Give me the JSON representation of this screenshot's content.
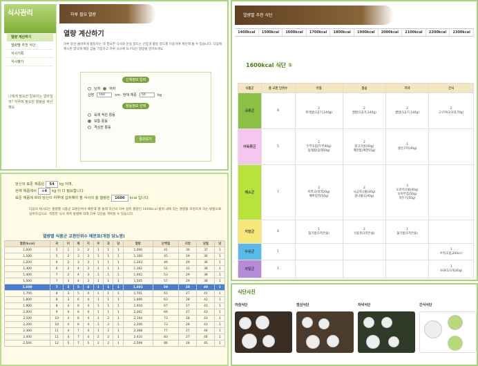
{
  "sidebar": {
    "title": "식사관리",
    "subtitle": "",
    "items": [
      "열량 계산하기",
      "열량별 추천 식단",
      "식사기록",
      "식사평가"
    ],
    "art_text": "나에게 필요한 칼로리는 얼마일까? 하루에 필요한 열량을 계산해요"
  },
  "calc": {
    "banner": "하루 필요 열량",
    "title": "열량 계산하기",
    "desc": "하루 동안 올바르게 활동하는 데 필요한 식사와 운동 정도는 신장과 활동 정도를 이용하여 계산해 볼 수 있습니다. 다음에 제시된 양식에 해당 값을 기입하고 하루 식사에 요구되는 열량을 알아보세요.",
    "sec1": "신체정보 입력",
    "gender_m": "남자",
    "gender_f": "여자",
    "height_label": "신장",
    "height_value": "160",
    "height_unit": "cm",
    "weight_label": "현재 체중",
    "weight_value": "50",
    "weight_unit": "kg",
    "sec2": "활동정보 선택",
    "act1": "육체 적은 활동",
    "act2": "보통 활동",
    "act3": "격심한 활동",
    "button": "결과보기"
  },
  "result": {
    "line1a": "당신의 표준 체중은",
    "std_weight": "54",
    "line1b": "kg 이며,",
    "line2a": "현재 체중에서",
    "diff": "+4",
    "line2b": "kg 이 더 필요합니다.",
    "line3a": "표준 체중에 따라 당신이 하루에 섭취해야 할 식사의 총 열량은",
    "kcal": "1600",
    "line3b": "kcal 입니다.",
    "note": "다음의 제시되는 열량별 식품군 교환단위수 배분표 를 통해 자신의 하루 섭취 열량인 1600kcal 범위 내에 있는 열량을 작성하게 하는 방법으로 섭취하십시오. 적정한 식사 계획 방법에 대해 하루 식단을 계획할 수 있습니다.",
    "table_title": "열량별 식품군 교환단위수 배분표(개정 당뇨병)",
    "headers": [
      "열량(kcal)",
      "곡",
      "어",
      "채",
      "지",
      "우",
      "과",
      "당",
      "열량",
      "단백질",
      "지방",
      "당질",
      "당",
      "단",
      "지"
    ],
    "rows": [
      [
        "1,000",
        "5",
        "1",
        "3",
        "2",
        "1",
        "1",
        "1",
        "1,000",
        "41",
        "30",
        "37",
        "1"
      ],
      [
        "1,100",
        "5",
        "2",
        "3",
        "3",
        "1",
        "1",
        "1",
        "1,100",
        "45",
        "29",
        "36",
        "1"
      ],
      [
        "1,200",
        "6",
        "2",
        "3",
        "3",
        "1",
        "1",
        "1",
        "1,203",
        "49",
        "29",
        "36",
        "1"
      ],
      [
        "1,300",
        "6",
        "2",
        "4",
        "3",
        "1",
        "1",
        "1",
        "1,302",
        "51",
        "31",
        "38",
        "1"
      ],
      [
        "1,400",
        "7",
        "2",
        "4",
        "3",
        "1",
        "1",
        "1",
        "1,402",
        "53",
        "29",
        "38",
        "1"
      ],
      [
        "1,500",
        "7",
        "3",
        "4",
        "3",
        "1",
        "1",
        "1",
        "1,505",
        "57",
        "29",
        "38",
        "1"
      ],
      [
        "1,600",
        "7",
        "3",
        "5",
        "4",
        "1",
        "1",
        "1",
        "1,601",
        "59",
        "28",
        "40",
        "1"
      ],
      [
        "1,700",
        "8",
        "3",
        "5",
        "4",
        "1",
        "1",
        "1",
        "1,701",
        "61",
        "27",
        "41",
        "1"
      ],
      [
        "1,800",
        "8",
        "3",
        "6",
        "4",
        "1",
        "1",
        "1",
        "1,806",
        "63",
        "28",
        "42",
        "1"
      ],
      [
        "1,900",
        "8",
        "4",
        "6",
        "4",
        "1",
        "1",
        "1",
        "1,910",
        "67",
        "27",
        "43",
        "1"
      ],
      [
        "2,000",
        "9",
        "4",
        "6",
        "4",
        "1",
        "1",
        "1",
        "2,002",
        "69",
        "27",
        "43",
        "1"
      ],
      [
        "2,100",
        "10",
        "4",
        "6",
        "4",
        "1",
        "2",
        "1",
        "2,104",
        "73",
        "28",
        "43",
        "1"
      ],
      [
        "2,200",
        "10",
        "4",
        "6",
        "4",
        "1",
        "2",
        "1",
        "2,206",
        "73",
        "28",
        "43",
        "1"
      ],
      [
        "2,300",
        "11",
        "4",
        "7",
        "4",
        "1",
        "2",
        "1",
        "2,308",
        "77",
        "27",
        "44",
        "1"
      ],
      [
        "2,400",
        "11",
        "4",
        "7",
        "4",
        "2",
        "2",
        "1",
        "2,410",
        "83",
        "27",
        "44",
        "1"
      ],
      [
        "2,500",
        "12",
        "5",
        "7",
        "5",
        "2",
        "2",
        "1",
        "2,509",
        "86",
        "28",
        "45",
        "1"
      ]
    ],
    "highlight_row": 6
  },
  "recommend": {
    "banner": "열량별 추천 식단",
    "tabs": [
      "1400kcal",
      "1500kcal",
      "1600kcal",
      "1700kcal",
      "1800kcal",
      "1900kcal",
      "2000kcal",
      "2100kcal",
      "2200kcal",
      "2300kcal"
    ],
    "menu_title": "1600kcal 식단 ①",
    "cols": [
      "식품군",
      "총 교환 단위수",
      "아침",
      "점심",
      "저녁",
      "간식"
    ],
    "groups": [
      {
        "name": "곡류군",
        "units": "8",
        "b": "2\n흑미밥(1공기,140g)",
        "l": "2\n쌀밥(1공기,140g)",
        "d": "2\n쌀밥(1공기,140g)",
        "s": "2\n고구마(2/3개,70g)",
        "cls": "gc1"
      },
      {
        "name": "어육류군",
        "units": "5",
        "b": "2\n두부조림(두부40g)\n동태찜(동태50g)",
        "l": "2\n닭고기살(40g)\n계란찜(계란55g)",
        "d": "1\n생선구이(40g)",
        "s": "",
        "cls": "gc2"
      },
      {
        "name": "채소군",
        "units": "7",
        "b": "2\n미역국(미역20g)\n배추김치(50g)",
        "l": "2\n시금치나물(40g)\n콩나물국(40g)",
        "d": "3\n도라지나물(40g)\n오이무침(50g)\n깍두기(50g)",
        "s": "",
        "cls": "gc3"
      },
      {
        "name": "지방군",
        "units": "4",
        "b": "1\n참기름(1작은술)",
        "l": "2\n식용유(1작은술)",
        "d": "1\n들기름(1작은술)",
        "s": "",
        "cls": "gc4"
      },
      {
        "name": "우유군",
        "units": "1",
        "b": "",
        "l": "",
        "d": "",
        "s": "1\n우유(1컵,200cc)",
        "cls": "gc5"
      },
      {
        "name": "과일군",
        "units": "1",
        "b": "",
        "l": "",
        "d": "",
        "s": "1\n사과(1/3개,80g)",
        "cls": "gc6"
      }
    ]
  },
  "photos": {
    "title": "식단사진",
    "items": [
      "아침식단",
      "점심식단",
      "저녁식단",
      "간식식단"
    ]
  }
}
